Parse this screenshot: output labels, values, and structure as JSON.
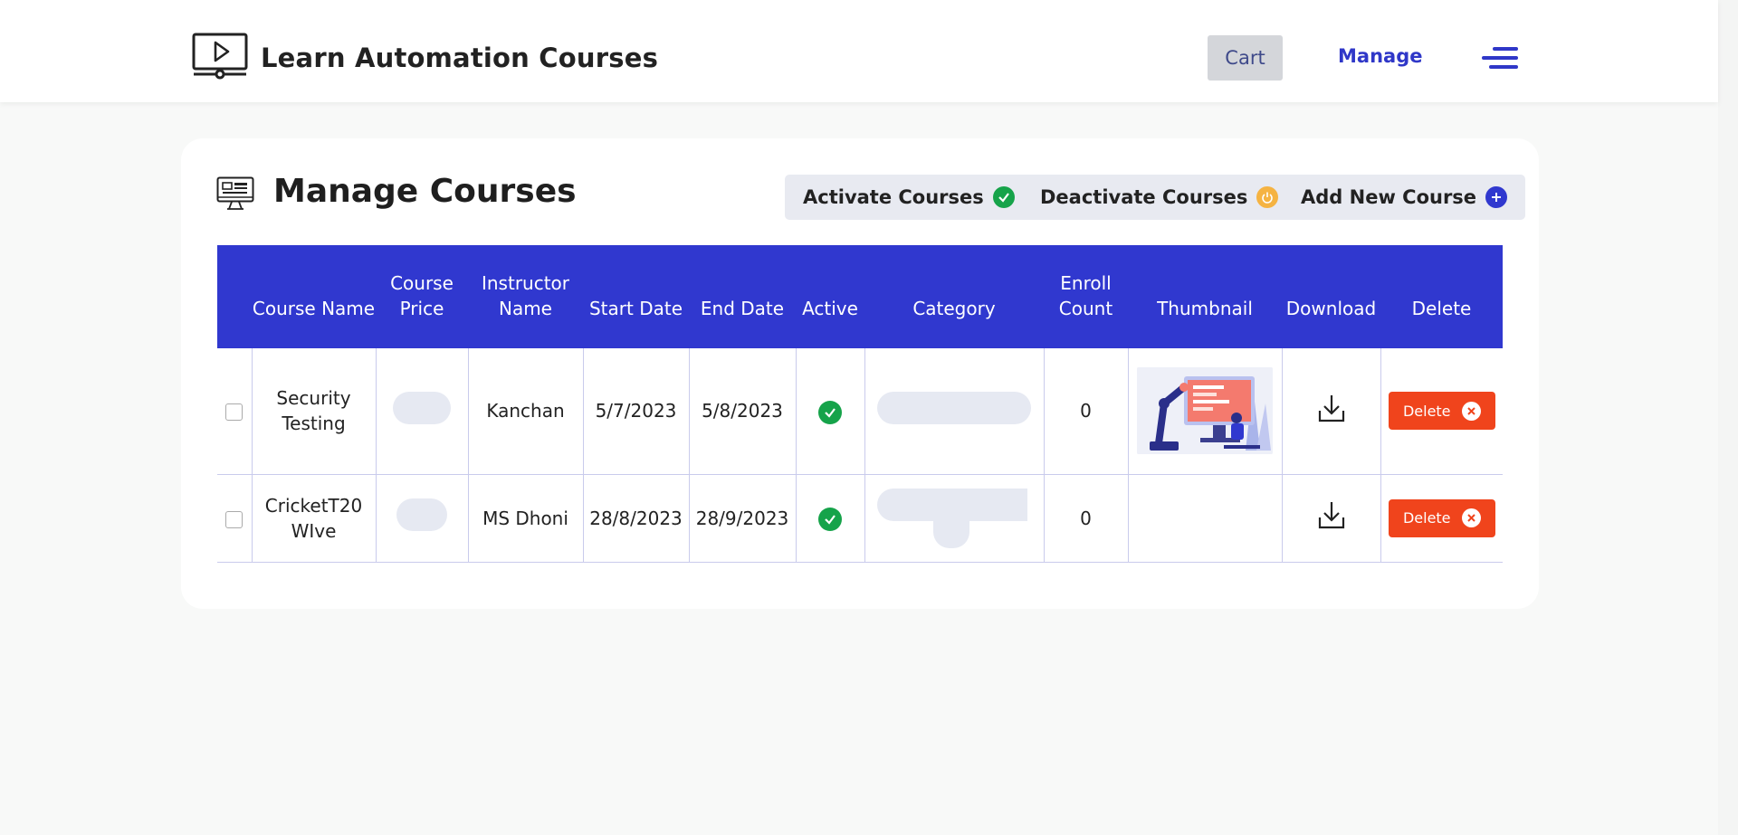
{
  "header": {
    "title": "Learn Automation Courses",
    "cart_label": "Cart",
    "manage_label": "Manage"
  },
  "page": {
    "title": "Manage Courses",
    "actions": {
      "activate": "Activate Courses",
      "deactivate": "Deactivate Courses",
      "add": "Add New Course"
    }
  },
  "table": {
    "columns": {
      "course_name": "Course Name",
      "course_price": "Course Price",
      "instructor_name": "Instructor Name",
      "start_date": "Start Date",
      "end_date": "End Date",
      "active": "Active",
      "category": "Category",
      "enroll_count": "Enroll Count",
      "thumbnail": "Thumbnail",
      "download": "Download",
      "delete": "Delete"
    },
    "rows": [
      {
        "course_name": "Security Testing",
        "instructor": "Kanchan",
        "start_date": "5/7/2023",
        "end_date": "5/8/2023",
        "enroll_count": "0",
        "delete_label": "Delete"
      },
      {
        "course_name": "CricketT20 WIve",
        "instructor": "MS Dhoni",
        "start_date": "28/8/2023",
        "end_date": "28/9/2023",
        "enroll_count": "0",
        "delete_label": "Delete"
      }
    ]
  },
  "colors": {
    "primary": "#3038cf",
    "success": "#16a34a",
    "warning": "#f5b342",
    "danger": "#f0441c"
  },
  "icons": {
    "brand": "monitor-play-icon",
    "page": "desktop-dashboard-icon",
    "menu": "menu-icon",
    "active": "check-circle-icon",
    "deactivate": "power-icon",
    "add": "plus-circle-icon",
    "download": "download-icon",
    "delete": "close-circle-icon"
  }
}
